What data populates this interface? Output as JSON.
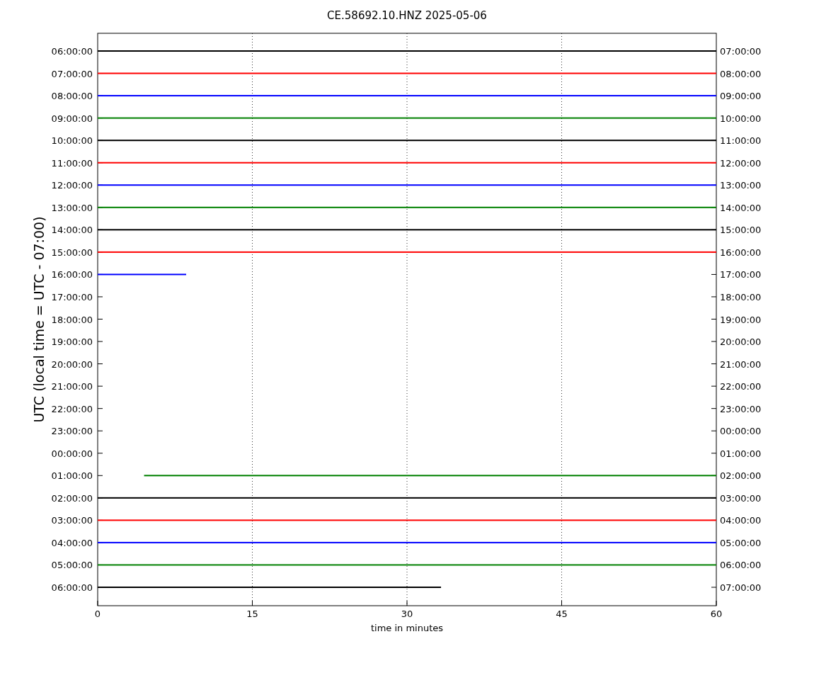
{
  "title": "CE.58692.10.HNZ 2025-05-06",
  "ylabel": "UTC (local time = UTC - 07:00)",
  "xlabel": "time in minutes",
  "xticks": [
    "0",
    "15",
    "30",
    "45",
    "60"
  ],
  "rows": [
    {
      "left": "06:00:00",
      "right": "07:00:00",
      "trace": {
        "color": "#000000",
        "kind": "full"
      }
    },
    {
      "left": "07:00:00",
      "right": "08:00:00",
      "trace": {
        "color": "#ff0000",
        "kind": "full"
      }
    },
    {
      "left": "08:00:00",
      "right": "09:00:00",
      "trace": {
        "color": "#0000ff",
        "kind": "full"
      }
    },
    {
      "left": "09:00:00",
      "right": "10:00:00",
      "trace": {
        "color": "#008000",
        "kind": "full"
      }
    },
    {
      "left": "10:00:00",
      "right": "11:00:00",
      "trace": {
        "color": "#000000",
        "kind": "full"
      }
    },
    {
      "left": "11:00:00",
      "right": "12:00:00",
      "trace": {
        "color": "#ff0000",
        "kind": "full"
      }
    },
    {
      "left": "12:00:00",
      "right": "13:00:00",
      "trace": {
        "color": "#0000ff",
        "kind": "full"
      }
    },
    {
      "left": "13:00:00",
      "right": "14:00:00",
      "trace": {
        "color": "#008000",
        "kind": "full"
      }
    },
    {
      "left": "14:00:00",
      "right": "15:00:00",
      "trace": {
        "color": "#000000",
        "kind": "full"
      }
    },
    {
      "left": "15:00:00",
      "right": "16:00:00",
      "trace": {
        "color": "#ff0000",
        "kind": "full"
      }
    },
    {
      "left": "16:00:00",
      "right": "17:00:00",
      "trace": {
        "color": "#0000ff",
        "kind": "short"
      }
    },
    {
      "left": "17:00:00",
      "right": "18:00:00"
    },
    {
      "left": "18:00:00",
      "right": "19:00:00"
    },
    {
      "left": "19:00:00",
      "right": "20:00:00"
    },
    {
      "left": "20:00:00",
      "right": "21:00:00"
    },
    {
      "left": "21:00:00",
      "right": "22:00:00"
    },
    {
      "left": "22:00:00",
      "right": "23:00:00"
    },
    {
      "left": "23:00:00",
      "right": "00:00:00"
    },
    {
      "left": "00:00:00",
      "right": "01:00:00"
    },
    {
      "left": "01:00:00",
      "right": "02:00:00",
      "trace": {
        "color": "#008000",
        "kind": "late"
      }
    },
    {
      "left": "02:00:00",
      "right": "03:00:00",
      "trace": {
        "color": "#000000",
        "kind": "full"
      }
    },
    {
      "left": "03:00:00",
      "right": "04:00:00",
      "trace": {
        "color": "#ff0000",
        "kind": "full"
      }
    },
    {
      "left": "04:00:00",
      "right": "05:00:00",
      "trace": {
        "color": "#0000ff",
        "kind": "full"
      }
    },
    {
      "left": "05:00:00",
      "right": "06:00:00",
      "trace": {
        "color": "#008000",
        "kind": "full"
      }
    },
    {
      "left": "06:00:00",
      "right": "07:00:00",
      "trace": {
        "color": "#000000",
        "kind": "half"
      }
    }
  ]
}
